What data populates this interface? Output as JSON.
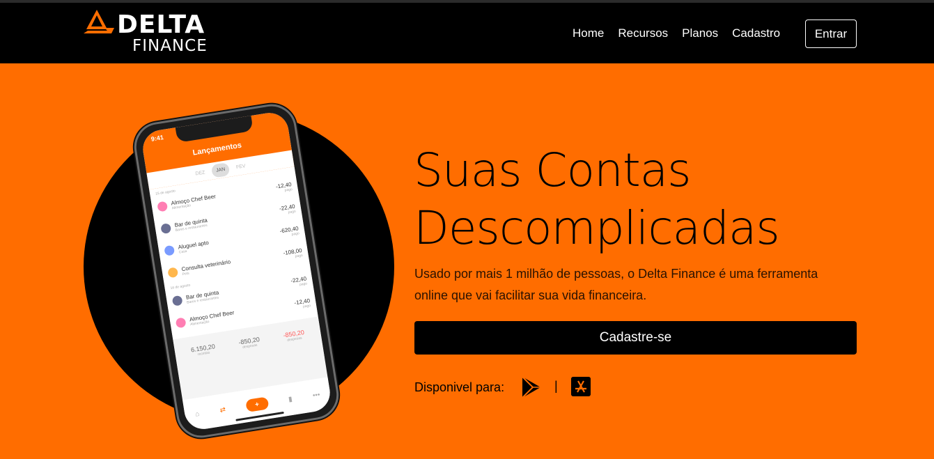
{
  "brand": {
    "name": "DELTA",
    "sub": "FINANCE"
  },
  "nav": {
    "links": [
      "Home",
      "Recursos",
      "Planos",
      "Cadastro"
    ],
    "login": "Entrar"
  },
  "phone": {
    "time": "9:41",
    "title": "Lançamentos",
    "months": [
      "DEZ",
      "JAN",
      "FEV"
    ],
    "sections": [
      "15 de agosto",
      "16 de agosto"
    ],
    "items": [
      {
        "name": "Almoço Chef Beer",
        "category": "Alimentação",
        "value": "-12,40",
        "status": "pago"
      },
      {
        "name": "Bar de quinta",
        "category": "Bares e restaurantes",
        "value": "-22,40",
        "status": "pago"
      },
      {
        "name": "Aluguel apto",
        "category": "Casa",
        "value": "-620,40",
        "status": "pago"
      },
      {
        "name": "Consulta veterinário",
        "category": "Pets",
        "value": "-108,00",
        "status": "pago"
      },
      {
        "name": "Bar de quinta",
        "category": "Bares e restaurantes",
        "value": "-22,40",
        "status": "pago"
      },
      {
        "name": "Almoço Chef Beer",
        "category": "Alimentação",
        "value": "-12,40",
        "status": "pago"
      }
    ],
    "totals": [
      {
        "value": "6.150,20",
        "label": "receitas"
      },
      {
        "value": "-850,20",
        "label": "despesas"
      },
      {
        "value": "-850,20",
        "label": "despesas"
      }
    ]
  },
  "hero": {
    "title_line1": "Suas Contas",
    "title_line2": "Descomplicadas",
    "description": "Usado por mais 1 milhão de pessoas, o Delta Finance é uma ferramenta online que vai facilitar sua vida financeira.",
    "cta": "Cadastre-se",
    "available": "Disponivel para:",
    "separator": "|"
  },
  "colors": {
    "accent": "#ff6d00",
    "dark": "#000000"
  },
  "icons": [
    "delta-logo-icon",
    "google-play-icon",
    "app-store-icon"
  ]
}
